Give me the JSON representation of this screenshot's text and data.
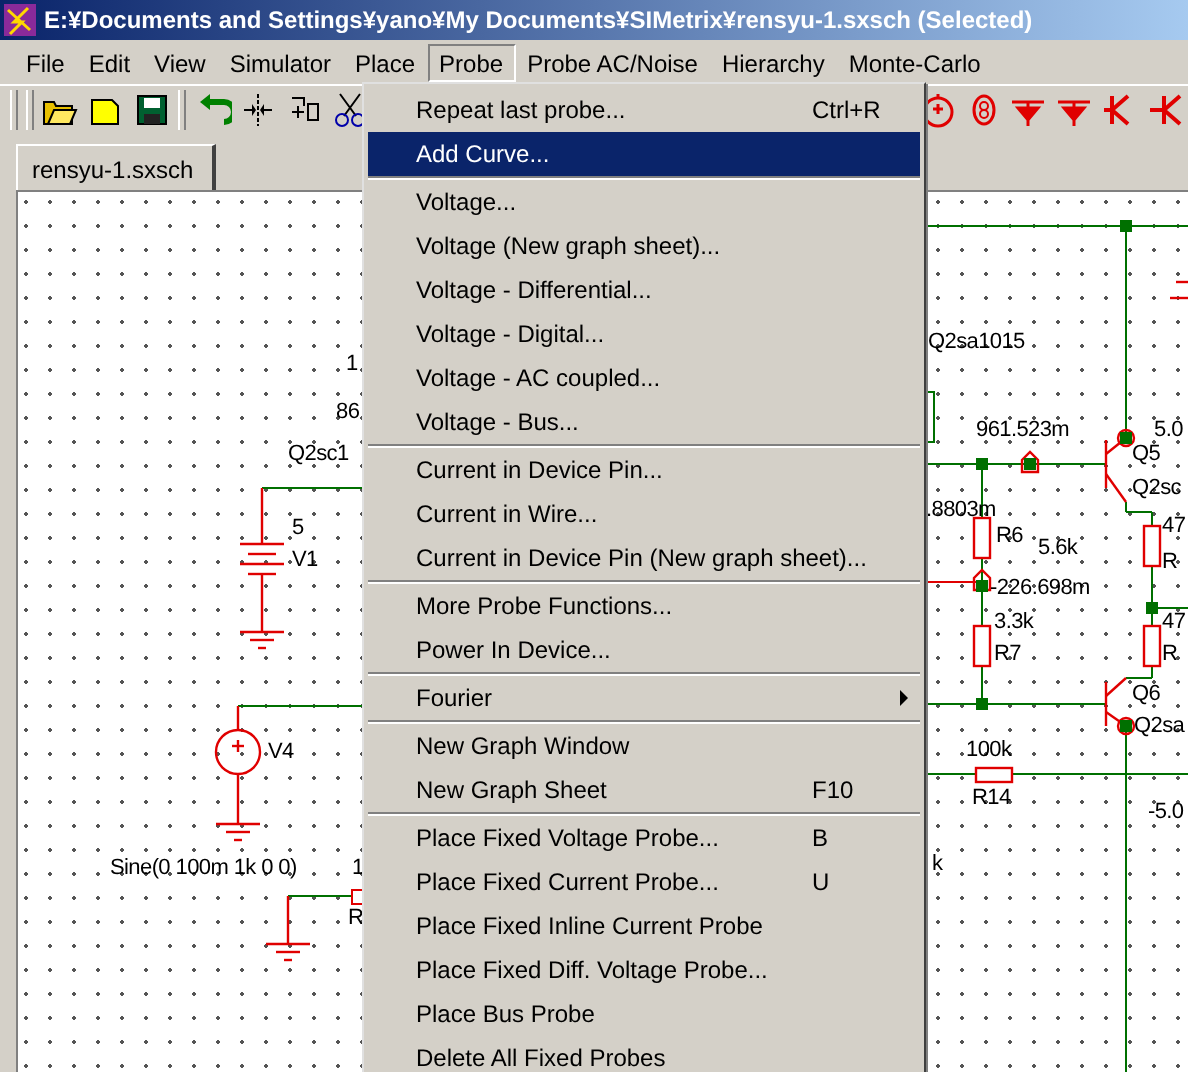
{
  "window": {
    "title": "E:¥Documents and Settings¥yano¥My Documents¥SIMetrix¥rensyu-1.sxsch (Selected)"
  },
  "menu_bar": [
    {
      "label": "File",
      "selected": false
    },
    {
      "label": "Edit",
      "selected": false
    },
    {
      "label": "View",
      "selected": false
    },
    {
      "label": "Simulator",
      "selected": false
    },
    {
      "label": "Place",
      "selected": false
    },
    {
      "label": "Probe",
      "selected": true
    },
    {
      "label": "Probe AC/Noise",
      "selected": false
    },
    {
      "label": "Hierarchy",
      "selected": false
    },
    {
      "label": "Monte-Carlo",
      "selected": false
    }
  ],
  "tabs": [
    {
      "label": "rensyu-1.sxsch",
      "selected": true
    }
  ],
  "probe_menu": {
    "items": [
      {
        "kind": "item",
        "label": "Repeat last probe...",
        "shortcut": "Ctrl+R",
        "selected": false
      },
      {
        "kind": "item",
        "label": "Add Curve...",
        "selected": true
      },
      {
        "kind": "separator"
      },
      {
        "kind": "item",
        "label": "Voltage...",
        "selected": false
      },
      {
        "kind": "item",
        "label": "Voltage (New graph sheet)...",
        "selected": false
      },
      {
        "kind": "item",
        "label": "Voltage - Differential...",
        "selected": false
      },
      {
        "kind": "item",
        "label": "Voltage - Digital...",
        "selected": false
      },
      {
        "kind": "item",
        "label": "Voltage - AC coupled...",
        "selected": false
      },
      {
        "kind": "item",
        "label": "Voltage - Bus...",
        "selected": false
      },
      {
        "kind": "separator"
      },
      {
        "kind": "item",
        "label": "Current in Device Pin...",
        "selected": false
      },
      {
        "kind": "item",
        "label": "Current in Wire...",
        "selected": false
      },
      {
        "kind": "item",
        "label": "Current in Device Pin (New graph sheet)...",
        "selected": false
      },
      {
        "kind": "separator"
      },
      {
        "kind": "item",
        "label": "More Probe Functions...",
        "selected": false
      },
      {
        "kind": "item",
        "label": "Power In Device...",
        "selected": false
      },
      {
        "kind": "separator"
      },
      {
        "kind": "submenu",
        "label": "Fourier",
        "selected": false
      },
      {
        "kind": "separator"
      },
      {
        "kind": "item",
        "label": "New Graph Window",
        "selected": false
      },
      {
        "kind": "item",
        "label": "New Graph Sheet",
        "shortcut": "F10",
        "selected": false
      },
      {
        "kind": "separator"
      },
      {
        "kind": "item",
        "label": "Place Fixed Voltage Probe...",
        "shortcut": "B",
        "selected": false
      },
      {
        "kind": "item",
        "label": "Place Fixed Current Probe...",
        "shortcut": "U",
        "selected": false
      },
      {
        "kind": "item",
        "label": "Place Fixed Inline Current Probe",
        "selected": false
      },
      {
        "kind": "item",
        "label": "Place Fixed Diff. Voltage Probe...",
        "selected": false
      },
      {
        "kind": "item",
        "label": "Place Bus Probe",
        "selected": false
      },
      {
        "kind": "item",
        "label": "Delete All Fixed Probes",
        "selected": false
      }
    ]
  },
  "schematic": {
    "labels": [
      "1",
      "86",
      "Q2sc1",
      "5",
      "V1",
      "V4",
      "Sine(0 100m 1k 0 0)",
      "1",
      "R",
      "Q2sa1015",
      "961.523m",
      "5.0",
      "Q5",
      "Q2sc",
      ".8803m",
      "R6",
      "5.6k",
      "47",
      "R",
      "-226.698m",
      "3.3k",
      "R7",
      "47",
      "R",
      "Q6",
      "Q2sa",
      "100k",
      "R14",
      "-5.0",
      "k"
    ]
  }
}
